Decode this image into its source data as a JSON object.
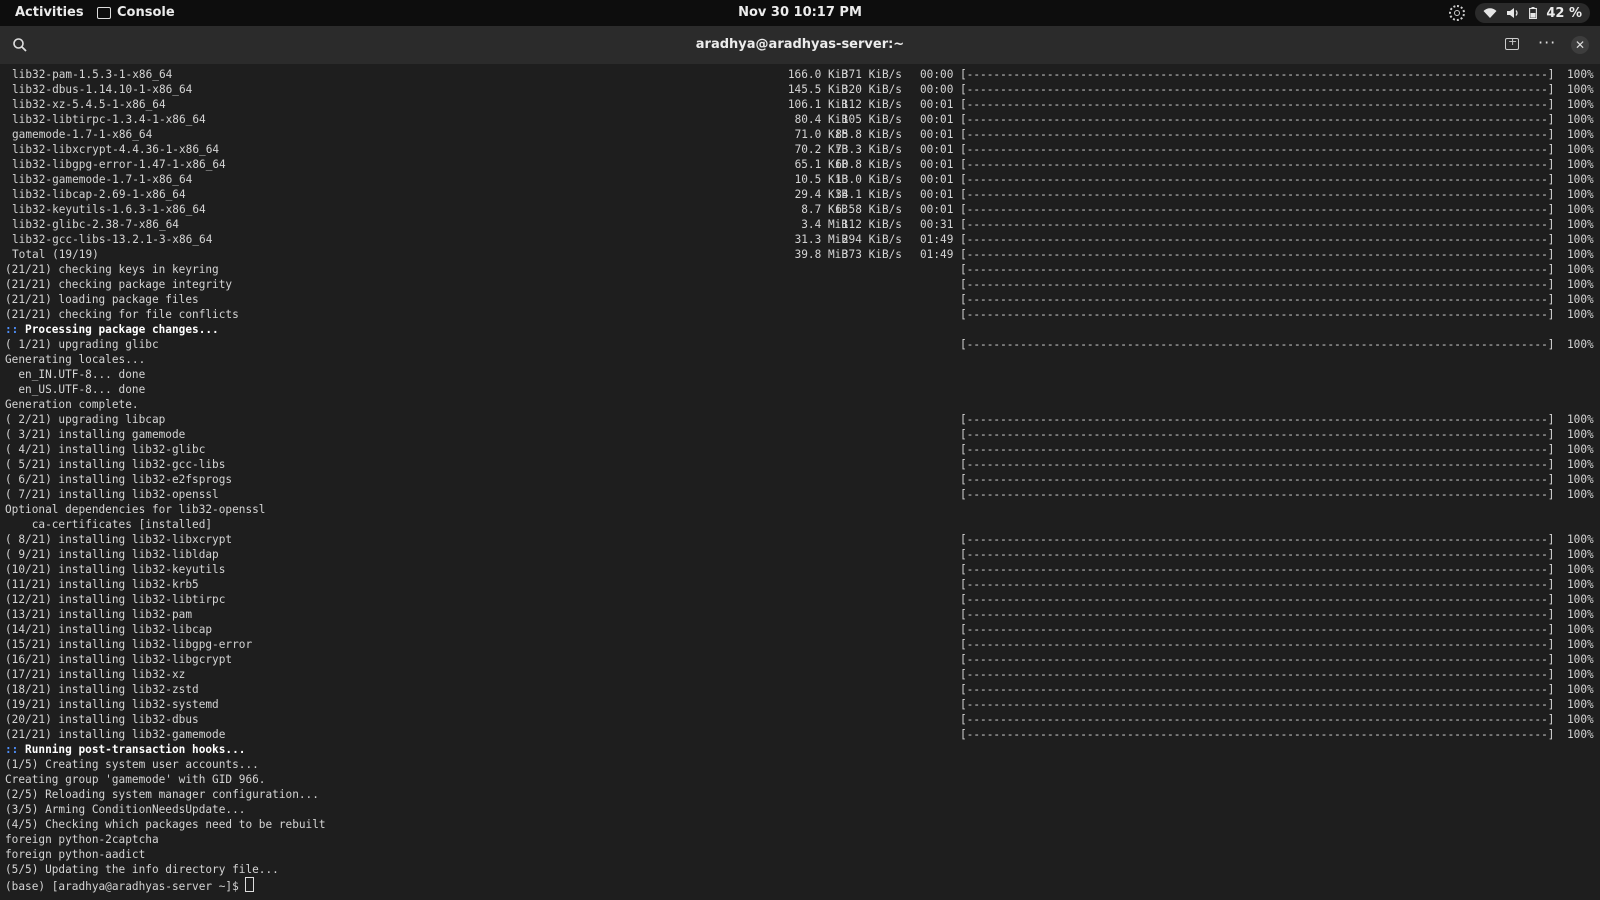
{
  "topbar": {
    "activities": "Activities",
    "app_name": "Console",
    "clock": "Nov 30  10:17 PM",
    "battery": "42 %"
  },
  "header": {
    "title": "aradhya@aradhyas-server:~"
  },
  "downloads": [
    {
      "name": "lib32-pam-1.5.3-1-x86_64",
      "size": "166.0 KiB",
      "rate": "371 KiB/s",
      "time": "00:00",
      "bar": "[---------------------------------------------------------------------------------------]",
      "pct": "100%"
    },
    {
      "name": "lib32-dbus-1.14.10-1-x86_64",
      "size": "145.5 KiB",
      "rate": "320 KiB/s",
      "time": "00:00",
      "bar": "[---------------------------------------------------------------------------------------]",
      "pct": "100%"
    },
    {
      "name": "lib32-xz-5.4.5-1-x86_64",
      "size": "106.1 KiB",
      "rate": "112 KiB/s",
      "time": "00:01",
      "bar": "[---------------------------------------------------------------------------------------]",
      "pct": "100%"
    },
    {
      "name": "lib32-libtirpc-1.3.4-1-x86_64",
      "size": "80.4 KiB",
      "rate": "105 KiB/s",
      "time": "00:01",
      "bar": "[---------------------------------------------------------------------------------------]",
      "pct": "100%"
    },
    {
      "name": "gamemode-1.7-1-x86_64",
      "size": "71.0 KiB",
      "rate": "85.8 KiB/s",
      "time": "00:01",
      "bar": "[---------------------------------------------------------------------------------------]",
      "pct": "100%"
    },
    {
      "name": "lib32-libxcrypt-4.4.36-1-x86_64",
      "size": "70.2 KiB",
      "rate": "73.3 KiB/s",
      "time": "00:01",
      "bar": "[---------------------------------------------------------------------------------------]",
      "pct": "100%"
    },
    {
      "name": "lib32-libgpg-error-1.47-1-x86_64",
      "size": "65.1 KiB",
      "rate": "60.8 KiB/s",
      "time": "00:01",
      "bar": "[---------------------------------------------------------------------------------------]",
      "pct": "100%"
    },
    {
      "name": "lib32-gamemode-1.7-1-x86_64",
      "size": "10.5 KiB",
      "rate": "13.0 KiB/s",
      "time": "00:01",
      "bar": "[---------------------------------------------------------------------------------------]",
      "pct": "100%"
    },
    {
      "name": "lib32-libcap-2.69-1-x86_64",
      "size": "29.4 KiB",
      "rate": "34.1 KiB/s",
      "time": "00:01",
      "bar": "[---------------------------------------------------------------------------------------]",
      "pct": "100%"
    },
    {
      "name": "lib32-keyutils-1.6.3-1-x86_64",
      "size": "8.7 KiB",
      "rate": "6.58 KiB/s",
      "time": "00:01",
      "bar": "[---------------------------------------------------------------------------------------]",
      "pct": "100%"
    },
    {
      "name": "lib32-glibc-2.38-7-x86_64",
      "size": "3.4 MiB",
      "rate": "112 KiB/s",
      "time": "00:31",
      "bar": "[---------------------------------------------------------------------------------------]",
      "pct": "100%"
    },
    {
      "name": "lib32-gcc-libs-13.2.1-3-x86_64",
      "size": "31.3 MiB",
      "rate": "294 KiB/s",
      "time": "01:49",
      "bar": "[---------------------------------------------------------------------------------------]",
      "pct": "100%"
    },
    {
      "name": "Total (19/19)",
      "size": "39.8 MiB",
      "rate": "373 KiB/s",
      "time": "01:49",
      "bar": "[---------------------------------------------------------------------------------------]",
      "pct": "100%"
    }
  ],
  "lines": [
    {
      "text": "(21/21) checking keys in keyring",
      "bar": "[---------------------------------------------------------------------------------------]",
      "pct": "100%"
    },
    {
      "text": "(21/21) checking package integrity",
      "bar": "[---------------------------------------------------------------------------------------]",
      "pct": "100%"
    },
    {
      "text": "(21/21) loading package files",
      "bar": "[---------------------------------------------------------------------------------------]",
      "pct": "100%"
    },
    {
      "text": "(21/21) checking for file conflicts",
      "bar": "[---------------------------------------------------------------------------------------]",
      "pct": "100%"
    },
    {
      "prefix": "::",
      "text": " Processing package changes...",
      "bold": true
    },
    {
      "text": "( 1/21) upgrading glibc",
      "bar": "[---------------------------------------------------------------------------------------]",
      "pct": "100%"
    },
    {
      "text": "Generating locales..."
    },
    {
      "text": "  en_IN.UTF-8... done"
    },
    {
      "text": "  en_US.UTF-8... done"
    },
    {
      "text": "Generation complete."
    },
    {
      "text": "( 2/21) upgrading libcap",
      "bar": "[---------------------------------------------------------------------------------------]",
      "pct": "100%"
    },
    {
      "text": "( 3/21) installing gamemode",
      "bar": "[---------------------------------------------------------------------------------------]",
      "pct": "100%"
    },
    {
      "text": "( 4/21) installing lib32-glibc",
      "bar": "[---------------------------------------------------------------------------------------]",
      "pct": "100%"
    },
    {
      "text": "( 5/21) installing lib32-gcc-libs",
      "bar": "[---------------------------------------------------------------------------------------]",
      "pct": "100%"
    },
    {
      "text": "( 6/21) installing lib32-e2fsprogs",
      "bar": "[---------------------------------------------------------------------------------------]",
      "pct": "100%"
    },
    {
      "text": "( 7/21) installing lib32-openssl",
      "bar": "[---------------------------------------------------------------------------------------]",
      "pct": "100%"
    },
    {
      "text": "Optional dependencies for lib32-openssl"
    },
    {
      "text": "    ca-certificates [installed]"
    },
    {
      "text": "( 8/21) installing lib32-libxcrypt",
      "bar": "[---------------------------------------------------------------------------------------]",
      "pct": "100%"
    },
    {
      "text": "( 9/21) installing lib32-libldap",
      "bar": "[---------------------------------------------------------------------------------------]",
      "pct": "100%"
    },
    {
      "text": "(10/21) installing lib32-keyutils",
      "bar": "[---------------------------------------------------------------------------------------]",
      "pct": "100%"
    },
    {
      "text": "(11/21) installing lib32-krb5",
      "bar": "[---------------------------------------------------------------------------------------]",
      "pct": "100%"
    },
    {
      "text": "(12/21) installing lib32-libtirpc",
      "bar": "[---------------------------------------------------------------------------------------]",
      "pct": "100%"
    },
    {
      "text": "(13/21) installing lib32-pam",
      "bar": "[---------------------------------------------------------------------------------------]",
      "pct": "100%"
    },
    {
      "text": "(14/21) installing lib32-libcap",
      "bar": "[---------------------------------------------------------------------------------------]",
      "pct": "100%"
    },
    {
      "text": "(15/21) installing lib32-libgpg-error",
      "bar": "[---------------------------------------------------------------------------------------]",
      "pct": "100%"
    },
    {
      "text": "(16/21) installing lib32-libgcrypt",
      "bar": "[---------------------------------------------------------------------------------------]",
      "pct": "100%"
    },
    {
      "text": "(17/21) installing lib32-xz",
      "bar": "[---------------------------------------------------------------------------------------]",
      "pct": "100%"
    },
    {
      "text": "(18/21) installing lib32-zstd",
      "bar": "[---------------------------------------------------------------------------------------]",
      "pct": "100%"
    },
    {
      "text": "(19/21) installing lib32-systemd",
      "bar": "[---------------------------------------------------------------------------------------]",
      "pct": "100%"
    },
    {
      "text": "(20/21) installing lib32-dbus",
      "bar": "[---------------------------------------------------------------------------------------]",
      "pct": "100%"
    },
    {
      "text": "(21/21) installing lib32-gamemode",
      "bar": "[---------------------------------------------------------------------------------------]",
      "pct": "100%"
    },
    {
      "prefix": "::",
      "text": " Running post-transaction hooks...",
      "bold": true
    },
    {
      "text": "(1/5) Creating system user accounts..."
    },
    {
      "text": "Creating group 'gamemode' with GID 966."
    },
    {
      "text": "(2/5) Reloading system manager configuration..."
    },
    {
      "text": "(3/5) Arming ConditionNeedsUpdate..."
    },
    {
      "text": "(4/5) Checking which packages need to be rebuilt"
    },
    {
      "text": "foreign python-2captcha"
    },
    {
      "text": "foreign python-aadict"
    },
    {
      "text": "(5/5) Updating the info directory file..."
    }
  ],
  "prompt": "(base) [aradhya@aradhyas-server ~]$ "
}
